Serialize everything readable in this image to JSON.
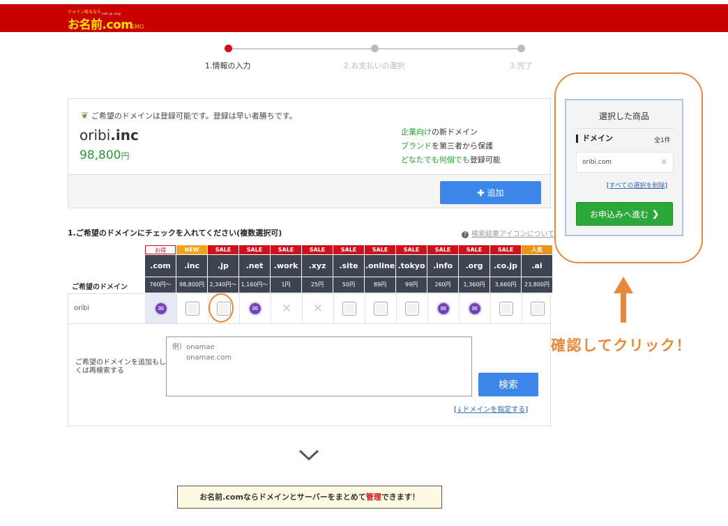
{
  "header": {
    "logo_small": "ドメイン取るなら",
    "logo_main": "お名前.com",
    "logo_tlds": ".com .jp .co.jp",
    "logo_gmo": "GMO"
  },
  "steps": [
    {
      "label": "1.情報の入力",
      "active": true
    },
    {
      "label": "2.お支払いの選択",
      "active": false
    },
    {
      "label": "3.完了",
      "active": false
    }
  ],
  "result": {
    "message": "ご希望のドメインは登録可能です。登録は早い者勝ちです。",
    "domain_base": "oribi",
    "domain_tld": ".inc",
    "price": "98,800",
    "price_unit": "円",
    "features": [
      {
        "hl": "企業向け",
        "rest": "の新ドメイン"
      },
      {
        "hl": "ブランド",
        "rest": "を第三者から保護"
      },
      {
        "hl": "どなたでも何個でも",
        "rest": "登録可能"
      }
    ],
    "add_label": "追加"
  },
  "section": {
    "title": "1.ご希望のドメインにチェックを入れてください(複数選択可)",
    "help_link": "検索結果アイコンについて"
  },
  "grid": {
    "row_header": "ご希望のドメイン",
    "row_name": "oribi",
    "columns": [
      {
        "badge": "お得",
        "badge_type": "osusume",
        "tld": ".com",
        "price": "760円～",
        "state": "mail"
      },
      {
        "badge": "NEW",
        "badge_type": "new",
        "tld": ".inc",
        "price": "98,800円",
        "state": "box"
      },
      {
        "badge": "SALE",
        "badge_type": "sale",
        "tld": ".jp",
        "price": "2,340円～",
        "state": "box"
      },
      {
        "badge": "SALE",
        "badge_type": "sale",
        "tld": ".net",
        "price": "1,160円～",
        "state": "mail"
      },
      {
        "badge": "SALE",
        "badge_type": "sale",
        "tld": ".work",
        "price": "1円",
        "state": "cross"
      },
      {
        "badge": "SALE",
        "badge_type": "sale",
        "tld": ".xyz",
        "price": "25円",
        "state": "cross"
      },
      {
        "badge": "SALE",
        "badge_type": "sale",
        "tld": ".site",
        "price": "50円",
        "state": "box"
      },
      {
        "badge": "SALE",
        "badge_type": "sale",
        "tld": ".online",
        "price": "89円",
        "state": "box"
      },
      {
        "badge": "SALE",
        "badge_type": "sale",
        "tld": ".tokyo",
        "price": "99円",
        "state": "box"
      },
      {
        "badge": "SALE",
        "badge_type": "sale",
        "tld": ".info",
        "price": "260円",
        "state": "mail"
      },
      {
        "badge": "SALE",
        "badge_type": "sale",
        "tld": ".org",
        "price": "1,360円",
        "state": "mail"
      },
      {
        "badge": "SALE",
        "badge_type": "sale",
        "tld": ".co.jp",
        "price": "3,660円",
        "state": "box"
      },
      {
        "badge": "人気",
        "badge_type": "pop",
        "tld": ".ai",
        "price": "23,800円",
        "state": "box"
      }
    ]
  },
  "search": {
    "label": "ご希望のドメインを追加もしくは再検索する",
    "placeholder": "例）onamae\n　　onamae.com",
    "button": "検索",
    "spec_link_prefix": "[",
    "spec_link": "↓ドメインを指定する",
    "spec_link_suffix": "]"
  },
  "banner": {
    "pre": "お名前.comならドメインとサーバーをまとめて",
    "red": "管理",
    "post": "できます！"
  },
  "cart": {
    "title": "選択した商品",
    "sub": "ドメイン",
    "count": "全1件",
    "item": "oribi.com",
    "clear_prefix": "[",
    "clear": "すべての選択を削除",
    "clear_suffix": "]",
    "proceed": "お申込みへ進む"
  },
  "annotation": {
    "text": "確認してクリック！",
    "color": "#e8883a"
  }
}
